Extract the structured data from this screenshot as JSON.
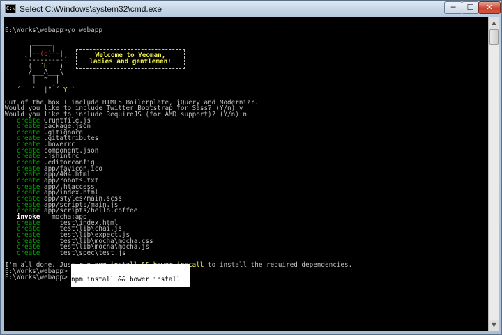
{
  "window": {
    "title": "Select C:\\Windows\\system32\\cmd.exe",
    "icon_text": "C:\\",
    "controls": {
      "minimize": "─",
      "maximize": "☐",
      "close": "✕"
    }
  },
  "banner": {
    "line1": "Welcome to Yeoman,",
    "line2": "ladies and gentlemen!"
  },
  "terminal": {
    "prompt_cmd": "E:\\Works\\webapp>yo webapp",
    "art": [
      "       _____",
      "      |     |",
      "      |--(o)--|",
      "     `---------´",
      "      ( _´U`_ )",
      "      /___A___\\",
      "       |  ~  |",
      "     __'.___.'__",
      "   ´   `  |° ´ Y `"
    ],
    "intro": "Out of the box I include HTML5 Boilerplate, jQuery and Modernizr.",
    "q1": "Would you like to include Twitter Bootstrap for Sass? (Y/n) y",
    "q2": "Would you like to include RequireJS (for AMD support)? (Y/n) n",
    "create_label": "create",
    "invoke_label": "invoke",
    "created_files": [
      "Gruntfile.js",
      "package.json",
      ".gitignore",
      ".gitattributes",
      ".bowerrc",
      "component.json",
      ".jshintrc",
      ".editorconfig",
      "app/favicon.ico",
      "app/404.html",
      "app/robots.txt",
      "app/.htaccess",
      "app/index.html",
      "app/styles/main.scss",
      "app/scripts/main.js",
      "app/scripts/hello.coffee"
    ],
    "invoke_target": "mocha:app",
    "test_files": [
      "test\\index.html",
      "test\\lib\\chai.js",
      "test\\lib\\expect.js",
      "test\\lib\\mocha\\mocha.css",
      "test\\lib\\mocha\\mocha.js",
      "test\\spec\\test.js"
    ],
    "done_prefix": "I'm all done. Just run ",
    "done_cmd": "npm install && bower install",
    "done_suffix": " to install the required dependencies.",
    "prompt2": "E:\\Works\\webapp>",
    "prompt3": "E:\\Works\\webapp>",
    "typed": "npm install && bower install"
  },
  "colors": {
    "create": "#00a800",
    "highlight": "#f0f050",
    "background": "#000000",
    "text": "#c0c0c0"
  }
}
